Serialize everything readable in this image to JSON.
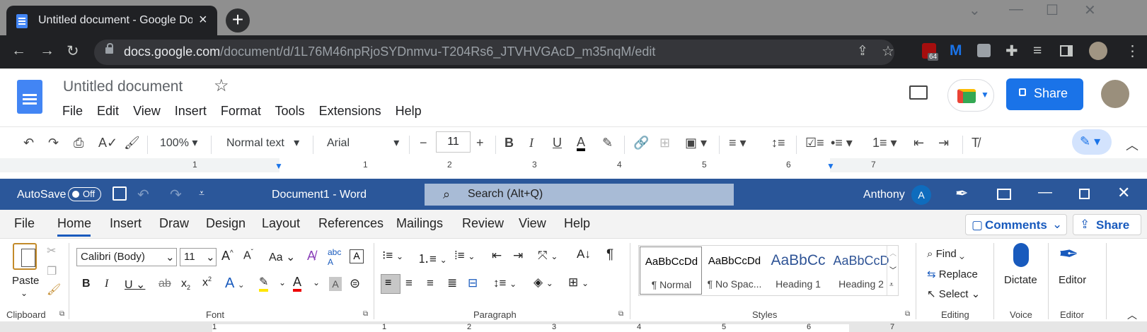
{
  "browser": {
    "tab_title": "Untitled document - Google Doc",
    "new_tab": "+",
    "url_host": "docs.google.com",
    "url_path": "/document/d/1L76M46npRjoSYDnmvu-T204Rs6_JTVHVGAcD_m35nqM/edit",
    "extension_badge": "64",
    "window_controls": [
      "⌄",
      "—",
      "☐",
      "✕"
    ]
  },
  "gdocs": {
    "title": "Untitled document",
    "menu": [
      "File",
      "Edit",
      "View",
      "Insert",
      "Format",
      "Tools",
      "Extensions",
      "Help"
    ],
    "share_label": "Share",
    "zoom": "100%",
    "style": "Normal text",
    "font": "Arial",
    "font_size": "11",
    "ruler": [
      "1",
      "1",
      "2",
      "3",
      "4",
      "5",
      "6",
      "7"
    ]
  },
  "word": {
    "autosave_label": "AutoSave",
    "autosave_state": "Off",
    "doc_title": "Document1  -  Word",
    "search_placeholder": "Search (Alt+Q)",
    "user_name": "Anthony",
    "user_initial": "A",
    "tabs": [
      "File",
      "Home",
      "Insert",
      "Draw",
      "Design",
      "Layout",
      "References",
      "Mailings",
      "Review",
      "View",
      "Help"
    ],
    "comments_label": "Comments",
    "share_label": "Share",
    "font_name": "Calibri (Body)",
    "font_size": "11",
    "paste_label": "Paste",
    "groups": [
      "Clipboard",
      "Font",
      "Paragraph",
      "Styles",
      "Editing",
      "Voice",
      "Editor"
    ],
    "styles": [
      {
        "sample": "AaBbCcDd",
        "name": "¶ Normal"
      },
      {
        "sample": "AaBbCcDd",
        "name": "¶ No Spac..."
      },
      {
        "sample": "AaBbCc",
        "name": "Heading 1"
      },
      {
        "sample": "AaBbCcD",
        "name": "Heading 2"
      }
    ],
    "editing": [
      "Find",
      "Replace",
      "Select"
    ],
    "dictate_label": "Dictate",
    "editor_label": "Editor",
    "ruler": [
      "1",
      "1",
      "2",
      "3",
      "4",
      "5",
      "6",
      "7"
    ]
  },
  "colors": {
    "chrome_dark": "#202124",
    "gdocs_blue": "#1a73e8",
    "word_blue": "#2b579a"
  }
}
